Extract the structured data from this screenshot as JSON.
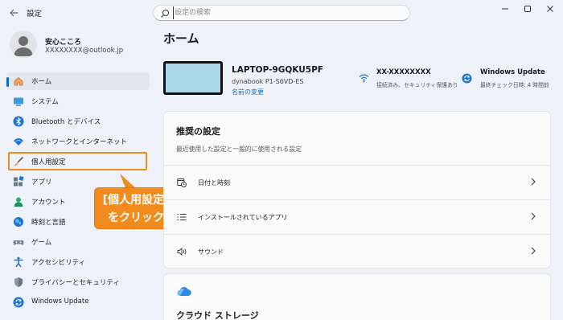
{
  "titlebar": {
    "app_title": "設定",
    "search_placeholder": "設定の検索"
  },
  "profile": {
    "name": "安心こころ",
    "email": "XXXXXXXX@outlook.jp"
  },
  "sidebar": {
    "items": [
      {
        "label": "ホーム",
        "icon": "home-icon",
        "active": true
      },
      {
        "label": "システム",
        "icon": "system-icon"
      },
      {
        "label": "Bluetooth とデバイス",
        "icon": "bluetooth-icon"
      },
      {
        "label": "ネットワークとインターネット",
        "icon": "network-icon"
      },
      {
        "label": "個人用設定",
        "icon": "brush-icon"
      },
      {
        "label": "アプリ",
        "icon": "apps-icon"
      },
      {
        "label": "アカウント",
        "icon": "account-icon"
      },
      {
        "label": "時刻と言語",
        "icon": "time-language-icon"
      },
      {
        "label": "ゲーム",
        "icon": "gaming-icon"
      },
      {
        "label": "アクセシビリティ",
        "icon": "accessibility-icon"
      },
      {
        "label": "プライバシーとセキュリティ",
        "icon": "shield-icon"
      },
      {
        "label": "Windows Update",
        "icon": "windows-update-icon"
      }
    ]
  },
  "callout": {
    "line1": "[個人用設定]",
    "line2": "をクリック",
    "color": "#f28b1e"
  },
  "main": {
    "title": "ホーム",
    "device": {
      "name": "LAPTOP-9GQKU5PF",
      "model": "dynabook P1-S6VD-ES",
      "rename": "名前の変更"
    },
    "network": {
      "name": "XX-XXXXXXXX",
      "status": "接続済み、セキュリティ保護あり"
    },
    "update": {
      "title": "Windows Update",
      "status": "最終チェック日時: 4 時間前"
    },
    "recommended": {
      "title": "推奨の設定",
      "subtitle": "最近使用した設定と一般的に使用される設定",
      "items": [
        {
          "label": "日付と時刻",
          "icon": "calendar-clock-icon"
        },
        {
          "label": "インストールされているアプリ",
          "icon": "list-icon"
        },
        {
          "label": "サウンド",
          "icon": "speaker-icon"
        }
      ]
    },
    "cloud": {
      "title": "クラウド ストレージ"
    }
  },
  "colors": {
    "accent": "#0f6cbd",
    "highlight": "#f28b1e"
  }
}
